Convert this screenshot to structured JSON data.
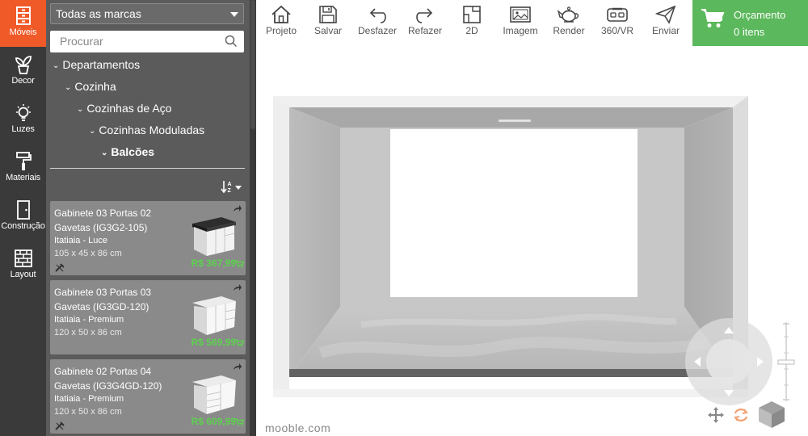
{
  "sidebar": {
    "items": [
      {
        "label": "Móveis",
        "icon": "cabinet-icon",
        "active": true
      },
      {
        "label": "Decor",
        "icon": "plant-icon"
      },
      {
        "label": "Luzes",
        "icon": "lightbulb-icon"
      },
      {
        "label": "Materiais",
        "icon": "paint-roller-icon"
      },
      {
        "label": "Construção",
        "icon": "door-icon"
      },
      {
        "label": "Layout",
        "icon": "brick-wall-icon"
      }
    ]
  },
  "catalog": {
    "brand_filter": "Todas as marcas",
    "search_placeholder": "Procurar",
    "tree": [
      {
        "label": "Departamentos"
      },
      {
        "label": "Cozinha"
      },
      {
        "label": "Cozinhas de Aço"
      },
      {
        "label": "Cozinhas Moduladas"
      },
      {
        "label": "Balcões",
        "selected": true
      }
    ],
    "products": [
      {
        "name": "Gabinete 03 Portas 02 Gavetas (IG3G2-105)",
        "brand": "Itatiaia - Luce",
        "dims": "105 x 45 x 86 cm",
        "price": "R$ 367,99"
      },
      {
        "name": "Gabinete 03 Portas 03 Gavetas (IG3GD-120)",
        "brand": "Itatiaia - Premium",
        "dims": "120 x 50 x 86 cm",
        "price": "R$ 569,99"
      },
      {
        "name": "Gabinete 02 Portas 04 Gavetas (IG3G4GD-120)",
        "brand": "Itatiaia - Premium",
        "dims": "120 x 50 x 86 cm",
        "price": "R$ 609,99"
      }
    ]
  },
  "toolbar": {
    "buttons": [
      {
        "label": "Projeto",
        "icon": "home-icon"
      },
      {
        "label": "Salvar",
        "icon": "save-icon"
      },
      {
        "label": "Desfazer",
        "icon": "undo-icon"
      },
      {
        "label": "Refazer",
        "icon": "redo-icon"
      },
      {
        "label": "2D",
        "icon": "floor-plan-icon"
      },
      {
        "label": "Imagem",
        "icon": "image-icon"
      },
      {
        "label": "Render",
        "icon": "teapot-icon"
      },
      {
        "label": "360/VR",
        "icon": "vr-headset-icon"
      },
      {
        "label": "Enviar",
        "icon": "send-icon"
      }
    ]
  },
  "budget": {
    "title": "Orçamento",
    "items": "0 itens"
  },
  "viewport": {
    "watermark": "mooble.com"
  },
  "colors": {
    "accent": "#f05a28",
    "budget_green": "#5cb85c",
    "price_green": "#5cd14e",
    "iconbar_bg": "#3a3a3a",
    "panel_bg": "#5b5b5b",
    "card_bg": "#8a8a8a"
  }
}
